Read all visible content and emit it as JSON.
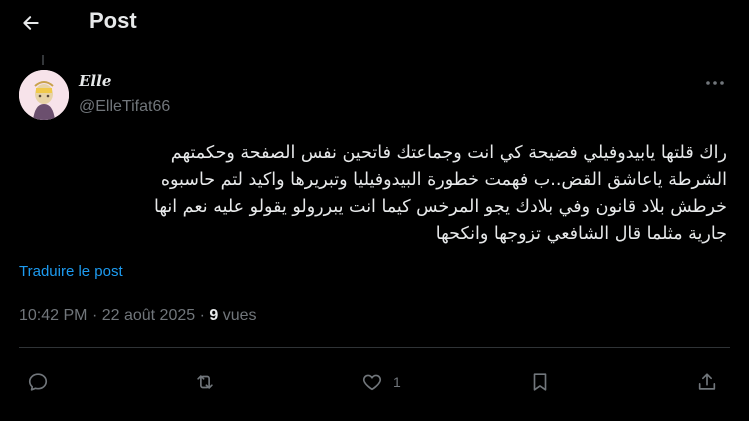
{
  "header": {
    "back_icon": "arrow-left-icon",
    "title": "Post"
  },
  "post": {
    "author": {
      "name": "𝑬𝒍𝒍𝒆",
      "handle": "@ElleTifat66",
      "avatar_icon": "avatar-image"
    },
    "more_icon": "ellipsis-icon",
    "text_lines": [
      "راك قلتها يابيدوفيلي فضيحة كي انت وجماعتك فاتحين نفس الصفحة وحكمتهم",
      "الشرطة ياعاشق القض..ب فهمت خطورة البيدوفيليا وتبريرها واكيد لتم حاسبوه",
      "خرطش بلاد قانون وفي بلادك يجو المرخس كيما انت يبررولو يقولو عليه نعم انها",
      "جارية مثلما قال الشافعي تزوجها وانكحها"
    ],
    "translate_label": "Traduire le post",
    "time": "10:42 PM",
    "separator": "·",
    "date": "22 août 2025",
    "views_count": "9",
    "views_label": "vues"
  },
  "actions": {
    "reply_icon": "reply-icon",
    "repost_icon": "repost-icon",
    "like_icon": "heart-icon",
    "like_count": "1",
    "bookmark_icon": "bookmark-icon",
    "share_icon": "share-icon"
  },
  "colors": {
    "background": "#000000",
    "text_primary": "#e7e9ea",
    "text_secondary": "#71767b",
    "link": "#1d9bf0",
    "divider": "#2f3336"
  }
}
